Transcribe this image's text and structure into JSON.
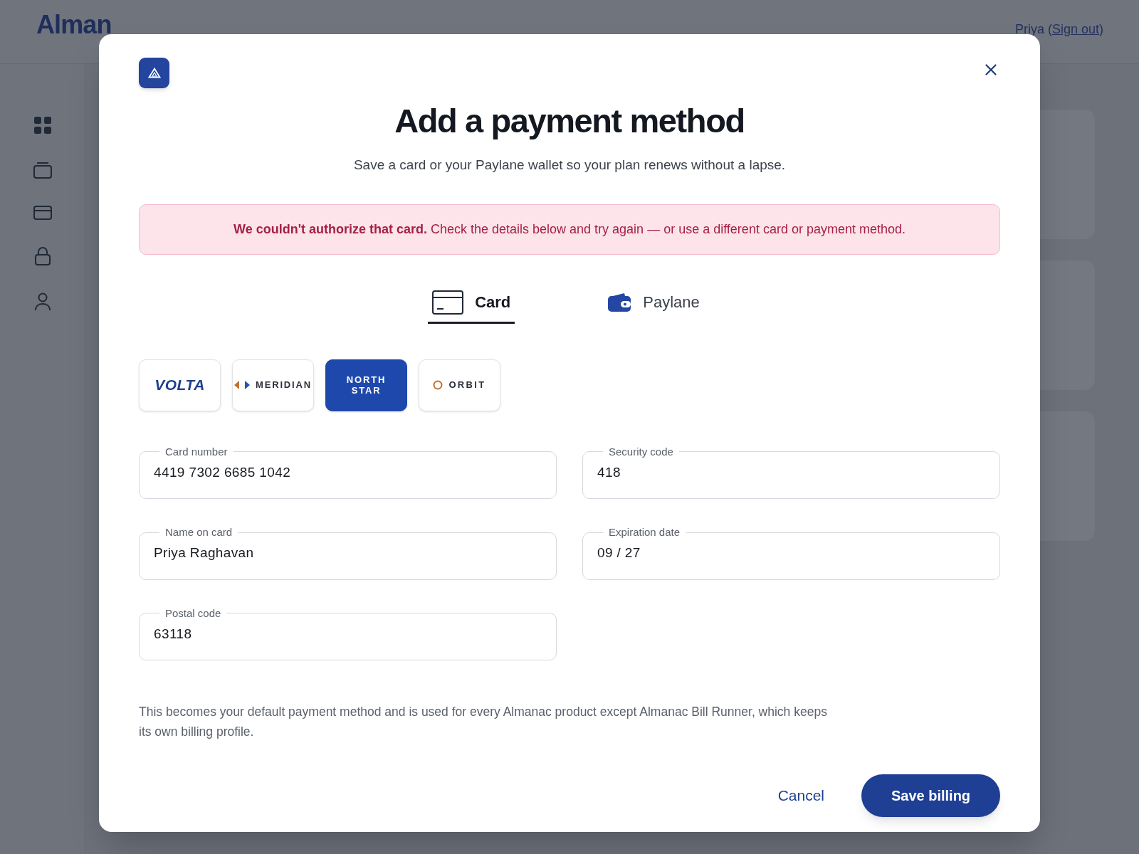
{
  "header": {
    "logo_text": "Alman",
    "account": {
      "name": "Priya",
      "open_paren": "(",
      "link": "Sign out",
      "close_paren": ")"
    }
  },
  "sidebar": {
    "items": [
      {
        "kind": "grid"
      },
      {
        "kind": "stack"
      },
      {
        "kind": "card"
      },
      {
        "kind": "lock"
      },
      {
        "kind": "user"
      }
    ]
  },
  "dialog": {
    "title": "Add a payment method",
    "subtitle": "Save a card or your Paylane wallet so your plan renews without a lapse.",
    "alert": {
      "title": "We couldn't authorize that card.",
      "message": "Check the details below and try again — or use a different card or payment method."
    },
    "tabs": [
      {
        "label": "Card",
        "kind": "card",
        "selected": true
      },
      {
        "label": "Paylane",
        "kind": "wallet",
        "selected": false
      }
    ],
    "brands": [
      {
        "label": "VOLTA",
        "kind": "volta",
        "selected": false
      },
      {
        "label": "MERIDIAN",
        "kind": "meridian",
        "selected": false
      },
      {
        "label": "NORTH STAR",
        "kind": "northstar",
        "selected": true
      },
      {
        "label": "ORBIT",
        "kind": "orbit",
        "selected": false
      }
    ],
    "fields": [
      {
        "label": "Card number",
        "value": "4419 7302 6685 1042"
      },
      {
        "label": "Security code",
        "value": "418"
      },
      {
        "label": "Name on card",
        "value": "Priya Raghavan"
      },
      {
        "label": "Expiration date",
        "value": "09 / 27"
      },
      {
        "label": "Postal code",
        "value": "63118"
      }
    ],
    "note": "This becomes your default payment method and is used for every Almanac product except Almanac Bill Runner, which keeps its own billing profile.",
    "buttons": {
      "cancel": "Cancel",
      "save": "Save billing"
    }
  }
}
